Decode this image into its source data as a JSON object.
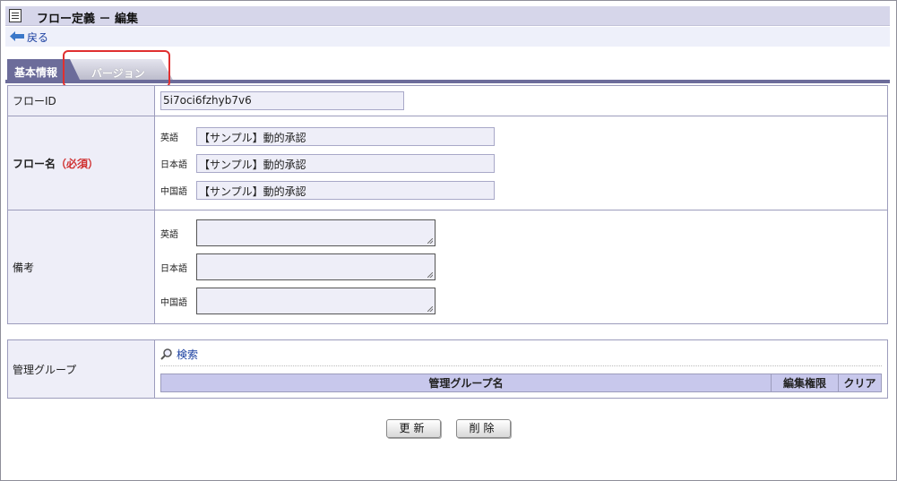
{
  "window": {
    "title": "フロー定義 － 編集",
    "back_label": "戻る"
  },
  "tabs": [
    {
      "label": "基本情報"
    },
    {
      "label": "バージョン"
    }
  ],
  "form": {
    "flow_id": {
      "label": "フローID",
      "value": "5i7oci6fzhyb7v6"
    },
    "flow_name": {
      "label": "フロー名",
      "required_mark": "（必須）",
      "rows": [
        {
          "lang": "英語",
          "value": "【サンプル】動的承認"
        },
        {
          "lang": "日本語",
          "value": "【サンプル】動的承認"
        },
        {
          "lang": "中国語",
          "value": "【サンプル】動的承認"
        }
      ]
    },
    "remarks": {
      "label": "備考",
      "rows": [
        {
          "lang": "英語",
          "value": ""
        },
        {
          "lang": "日本語",
          "value": ""
        },
        {
          "lang": "中国語",
          "value": ""
        }
      ]
    }
  },
  "management_group": {
    "label": "管理グループ",
    "search_label": "検索",
    "columns": [
      "管理グループ名",
      "編集権限",
      "クリア"
    ]
  },
  "buttons": {
    "update": "更新",
    "delete": "削除"
  }
}
